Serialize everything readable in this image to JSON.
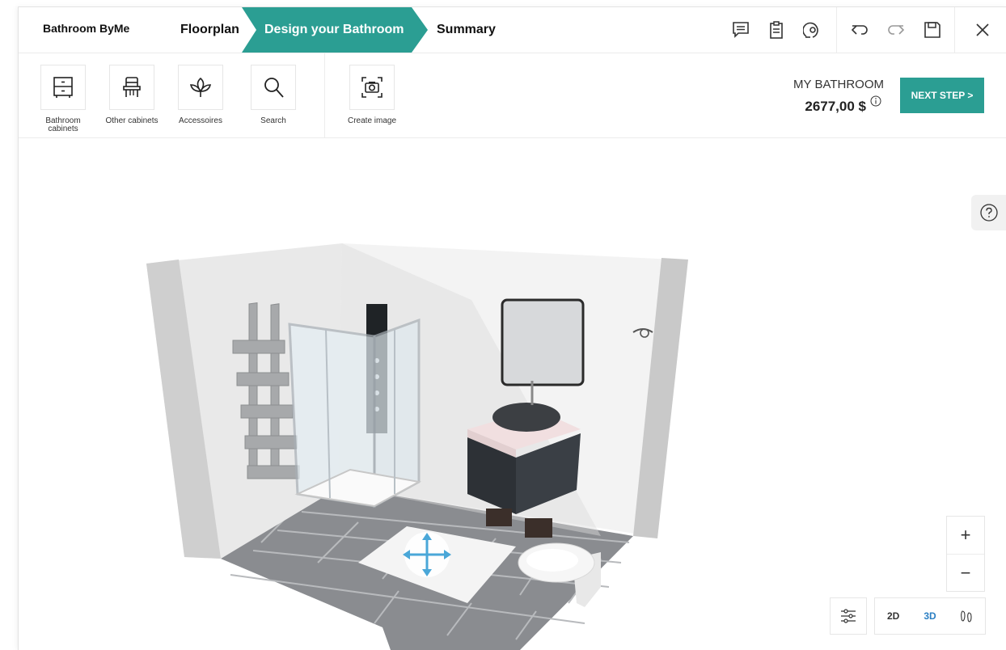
{
  "header": {
    "brand": "Bathroom ByMe",
    "steps": [
      "Floorplan",
      "Design your Bathroom",
      "Summary"
    ],
    "active_step": "Design your Bathroom",
    "accent_color": "#2b9e93",
    "icons": [
      "comment-icon",
      "clipboard-icon",
      "location-icon",
      "undo-icon",
      "redo-icon",
      "save-icon",
      "close-icon"
    ]
  },
  "tools": {
    "items": [
      {
        "label": "Bathroom cabinets",
        "icon": "cabinet-icon"
      },
      {
        "label": "Other cabinets",
        "icon": "chair-icon"
      },
      {
        "label": "Accessoires",
        "icon": "plant-icon"
      },
      {
        "label": "Search",
        "icon": "search-icon"
      },
      {
        "label": "Create image",
        "icon": "camera-icon"
      }
    ]
  },
  "price": {
    "title": "MY BATHROOM",
    "value": "2677,00 $"
  },
  "next_button": "NEXT STEP >",
  "view_controls": {
    "zoom_in": "+",
    "zoom_out": "−",
    "modes": [
      "2D",
      "3D"
    ],
    "active_mode": "3D",
    "active_color": "#2b7fc3"
  }
}
